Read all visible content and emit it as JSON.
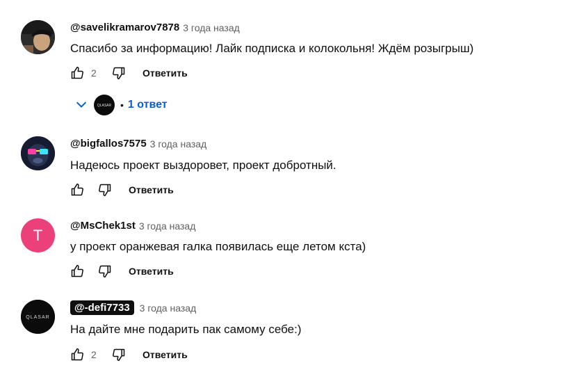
{
  "comments": [
    {
      "author": "@savelikramarov7878",
      "time": "3 года назад",
      "text": "Спасибо за информацию! Лайк подписка и колокольня! Ждём розыгрыш)",
      "likes": "2",
      "reply_label": "Ответить",
      "replies_label": "1 ответ",
      "avatar_icon": "person-photo-icon"
    },
    {
      "author": "@bigfallos7575",
      "time": "3 года назад",
      "text": "Надеюсь проект выздоровет, проект добротный.",
      "likes": "",
      "reply_label": "Ответить",
      "avatar_icon": "monkey-glasses-icon"
    },
    {
      "author": "@MsChek1st",
      "time": "3 года назад",
      "text": "у проект оранжевая галка появилась еще летом кста)",
      "likes": "",
      "reply_label": "Ответить",
      "avatar_letter": "T",
      "avatar_color": "#ec407a"
    },
    {
      "author": "@-defi7733",
      "time": "3 года назад",
      "text": "На дайте мне подарить пак самому себе:)",
      "likes": "2",
      "reply_label": "Ответить",
      "avatar_logo_text": "QLASAR"
    }
  ],
  "colors": {
    "link_blue": "#065fd4",
    "meta_gray": "#606060",
    "text_dark": "#0f0f0f"
  }
}
